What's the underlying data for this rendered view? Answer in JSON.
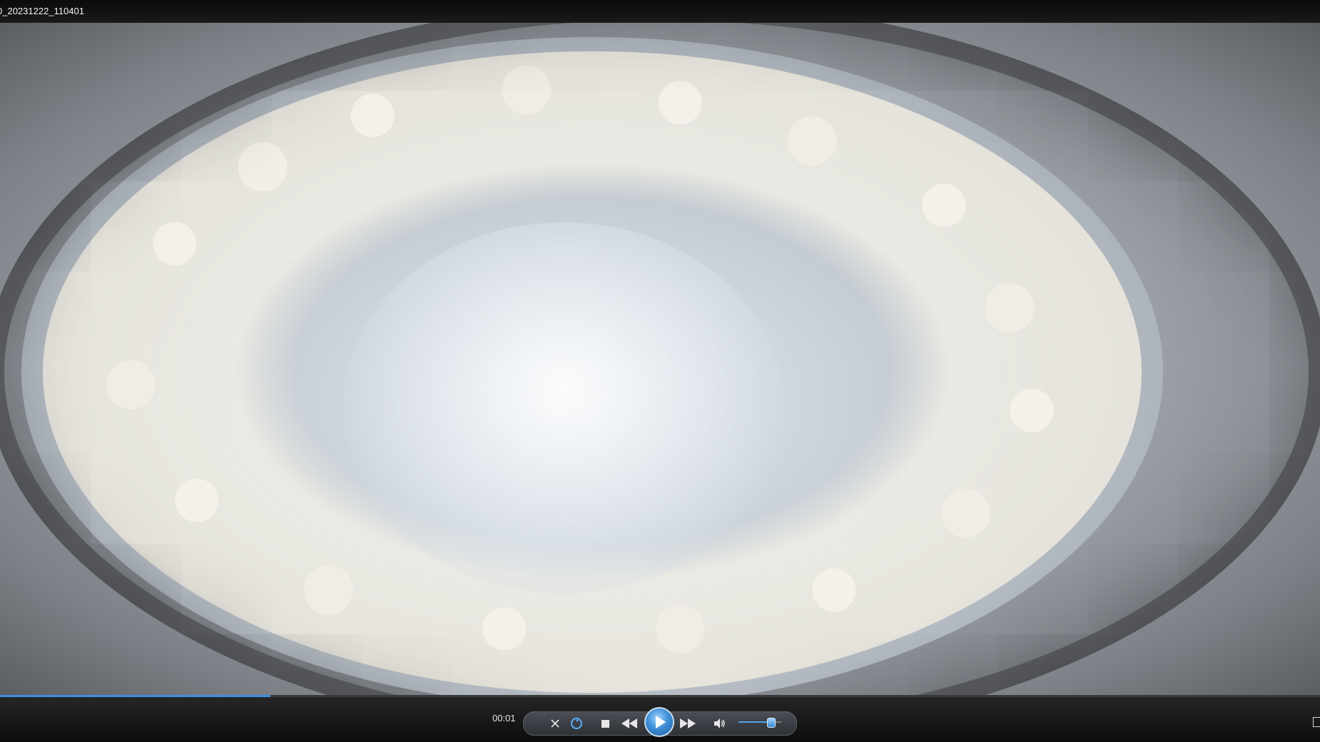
{
  "window": {
    "title": "0_20231222_110401"
  },
  "player": {
    "current_time": "00:01",
    "progress": 0.205,
    "volume": 0.75,
    "controls": {
      "switch_mode_icon": "switch-view-icon",
      "repeat_icon": "repeat-icon",
      "stop_icon": "stop-icon",
      "previous_icon": "rewind-icon",
      "play_icon": "play-icon",
      "next_icon": "fast-forward-icon",
      "volume_icon": "volume-icon",
      "fullscreen_icon": "fullscreen-icon"
    },
    "colors": {
      "accent": "#3c8fe0",
      "play_button": "#3f8fd6"
    }
  }
}
